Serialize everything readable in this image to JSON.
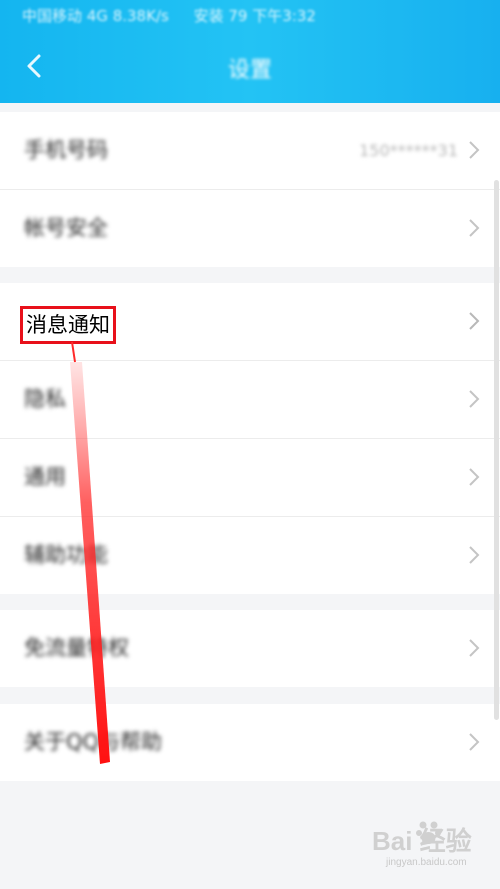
{
  "status_bar": {
    "left_text": "中国移动 4G  8.38K/s",
    "right_text": "安装 79  下午3:32"
  },
  "header": {
    "title": "设置"
  },
  "groups": [
    {
      "items": [
        {
          "label": "手机号码",
          "value": "150******31"
        },
        {
          "label": "帐号安全"
        }
      ]
    },
    {
      "items": [
        {
          "label": "消息通知"
        },
        {
          "label": "隐私"
        },
        {
          "label": "通用"
        },
        {
          "label": "辅助功能"
        }
      ]
    },
    {
      "items": [
        {
          "label": "免流量特权"
        }
      ]
    },
    {
      "items": [
        {
          "label": "关于QQ与帮助"
        }
      ]
    }
  ],
  "watermark": {
    "brand": "Bai 经验",
    "sub": "jingyan.baidu.com"
  },
  "colors": {
    "header_bg": "#1cbcf2",
    "highlight_border": "#e8101a",
    "annotation_arrow": "#ff2020"
  },
  "icons": {
    "back": "chevron-left-icon",
    "row_arrow": "chevron-right-icon",
    "watermark_logo": "paw-icon"
  }
}
